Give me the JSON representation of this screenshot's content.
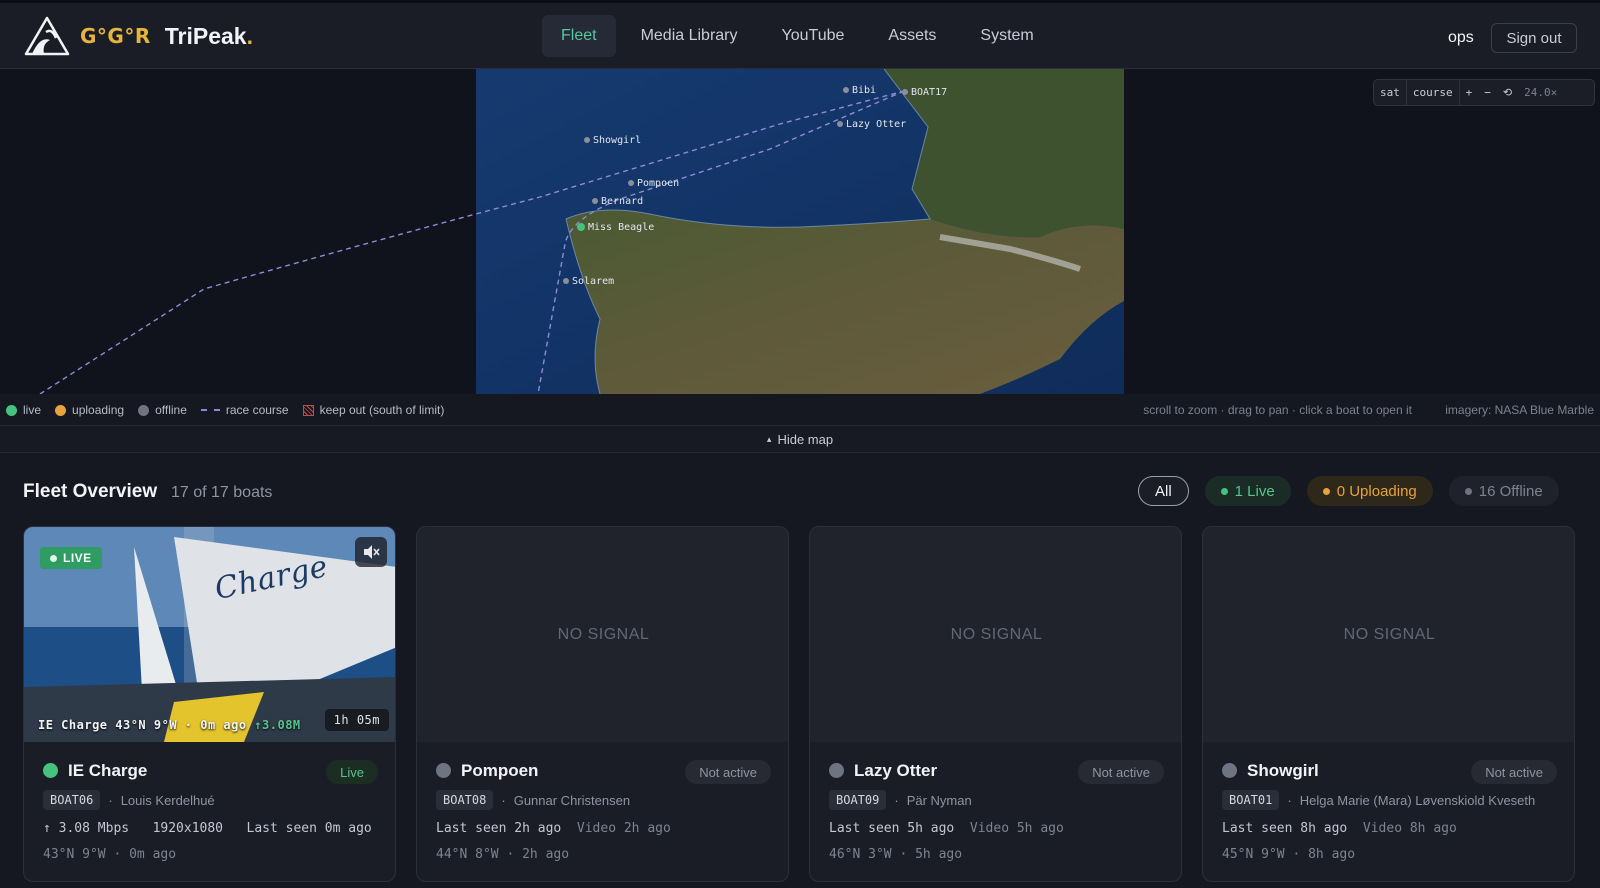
{
  "brand": {
    "prefix": "G°G°R",
    "name": "TriPeak",
    "dot": "."
  },
  "nav": {
    "tabs": [
      {
        "label": "Fleet",
        "active": true
      },
      {
        "label": "Media Library",
        "active": false
      },
      {
        "label": "YouTube",
        "active": false
      },
      {
        "label": "Assets",
        "active": false
      },
      {
        "label": "System",
        "active": false
      }
    ]
  },
  "user": {
    "name": "ops",
    "sign_out": "Sign out"
  },
  "map": {
    "controls": {
      "sat": "sat",
      "course": "course",
      "zoom_in": "+",
      "zoom_out": "−",
      "reset": "⟲",
      "zoom_level": "24.0×"
    },
    "boats": [
      {
        "label": "Bibi"
      },
      {
        "label": "BOAT17"
      },
      {
        "label": "Lazy Otter"
      },
      {
        "label": "Showgirl"
      },
      {
        "label": "Pompoen"
      },
      {
        "label": "Bernard"
      },
      {
        "label": "Miss Beagle"
      },
      {
        "label": "Solarem"
      }
    ],
    "legend": {
      "live": "live",
      "uploading": "uploading",
      "offline": "offline",
      "race_course": "race course",
      "keep_out": "keep out (south of limit)"
    },
    "hint": "scroll to zoom · drag to pan · click a boat to open it",
    "imagery": "imagery: NASA Blue Marble",
    "hide_map": "Hide map",
    "colors": {
      "live": "#45c27e",
      "uploading": "#e8a33b",
      "offline": "#6f7482",
      "course": "#8f8ad8"
    }
  },
  "fleet": {
    "title": "Fleet Overview",
    "count": "17 of 17 boats",
    "filters": {
      "all": "All",
      "live": "1 Live",
      "uploading": "0 Uploading",
      "offline": "16 Offline"
    },
    "cards": [
      {
        "name": "IE Charge",
        "status": "Live",
        "id": "BOAT06",
        "skipper": "Louis Kerdelhué",
        "stats": "↑ 3.08 Mbps   1920x1080   Last seen 0m ago",
        "position": "43°N 9°W · 0m ago",
        "badge": "LIVE",
        "overlay": "IE Charge 43°N 9°W · 0m ago ",
        "overlay_up": "↑3.08M",
        "duration": "1h 05m"
      },
      {
        "name": "Pompoen",
        "status": "Not active",
        "id": "BOAT08",
        "skipper": "Gunnar Christensen",
        "last_seen": "Last seen 2h ago",
        "video": "Video 2h ago",
        "position": "44°N 8°W · 2h ago",
        "video_text": "NO SIGNAL"
      },
      {
        "name": "Lazy Otter",
        "status": "Not active",
        "id": "BOAT09",
        "skipper": "Pär Nyman",
        "last_seen": "Last seen 5h ago",
        "video": "Video 5h ago",
        "position": "46°N 3°W · 5h ago",
        "video_text": "NO SIGNAL"
      },
      {
        "name": "Showgirl",
        "status": "Not active",
        "id": "BOAT01",
        "skipper": "Helga Marie (Mara) Løvenskiold Kveseth",
        "last_seen": "Last seen 8h ago",
        "video": "Video 8h ago",
        "position": "45°N 9°W · 8h ago",
        "video_text": "NO SIGNAL"
      }
    ]
  }
}
